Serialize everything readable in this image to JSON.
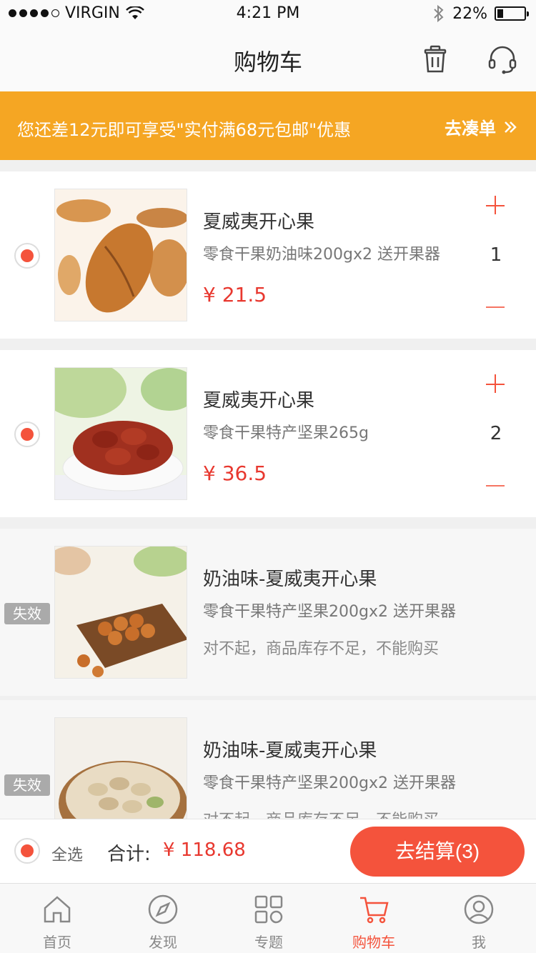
{
  "status_bar": {
    "carrier": "VIRGIN",
    "time": "4:21 PM",
    "battery": "22%",
    "battery_level": 0.22
  },
  "nav": {
    "title": "购物车"
  },
  "banner": {
    "text": "您还差12元即可享受\"实付满68元包邮\"优惠",
    "link": "去凑单"
  },
  "items": [
    {
      "name": "夏威夷开心果",
      "desc": "零食干果奶油味200gx2 送开果器",
      "price": "¥ 21.5",
      "qty": "1",
      "valid": true
    },
    {
      "name": "夏威夷开心果",
      "desc": "零食干果特产坚果265g",
      "price": "¥ 36.5",
      "qty": "2",
      "valid": true
    },
    {
      "name": "奶油味-夏威夷开心果",
      "desc": "零食干果特产坚果200gx2 送开果器",
      "note": "对不起，商品库存不足，不能购买",
      "badge": "失效",
      "valid": false
    },
    {
      "name": "奶油味-夏威夷开心果",
      "desc": "零食干果特产坚果200gx2 送开果器",
      "note": "对不起，商品库存不足，不能购买",
      "badge": "失效",
      "valid": false
    }
  ],
  "checkout": {
    "select_all": "全选",
    "total_label": "合计:",
    "total_value": "¥ 118.68",
    "pay_label": "去结算(3)"
  },
  "tabs": [
    {
      "label": "首页",
      "icon": "home-icon"
    },
    {
      "label": "发现",
      "icon": "compass-icon"
    },
    {
      "label": "专题",
      "icon": "grid-icon"
    },
    {
      "label": "购物车",
      "icon": "cart-icon",
      "active": true
    },
    {
      "label": "我",
      "icon": "user-icon"
    }
  ],
  "colors": {
    "accent": "#f4533c",
    "banner": "#f5a623",
    "price": "#e8382f"
  }
}
